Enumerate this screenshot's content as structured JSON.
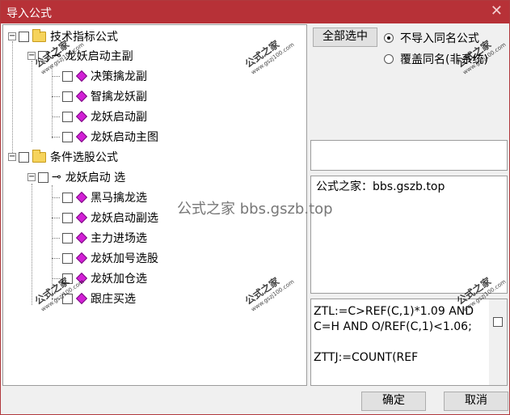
{
  "window": {
    "title": "导入公式",
    "close_glyph": "✕"
  },
  "tree": {
    "nodes": [
      {
        "label": "技术指标公式"
      },
      {
        "label": "龙妖启动主副"
      },
      {
        "label": "决策擒龙副"
      },
      {
        "label": "智擒龙妖副"
      },
      {
        "label": "龙妖启动副"
      },
      {
        "label": "龙妖启动主图"
      },
      {
        "label": "条件选股公式"
      },
      {
        "label": "龙妖启动 选"
      },
      {
        "label": "黑马擒龙选"
      },
      {
        "label": "龙妖启动副选"
      },
      {
        "label": "主力进场选"
      },
      {
        "label": "龙妖加号选股"
      },
      {
        "label": "龙妖加仓选"
      },
      {
        "label": "跟庄买选"
      }
    ],
    "expand_glyph": "−",
    "key_glyph": "⊸"
  },
  "options": {
    "select_all_label": "全部选中",
    "radio_no_import": "不导入同名公式",
    "radio_overwrite": "覆盖同名(非系统)"
  },
  "info": {
    "text": "公式之家：bbs.gszb.top"
  },
  "code": {
    "text": "ZTL:=C>REF(C,1)*1.09 AND\nC=H AND O/REF(C,1)<1.06;\n\nZTTJ:=COUNT(REF"
  },
  "buttons": {
    "ok": "确定",
    "cancel": "取消"
  },
  "watermark": {
    "text": "公式之家",
    "url": "www.gszj100.com",
    "center": "公式之家 bbs.gszb.top"
  }
}
